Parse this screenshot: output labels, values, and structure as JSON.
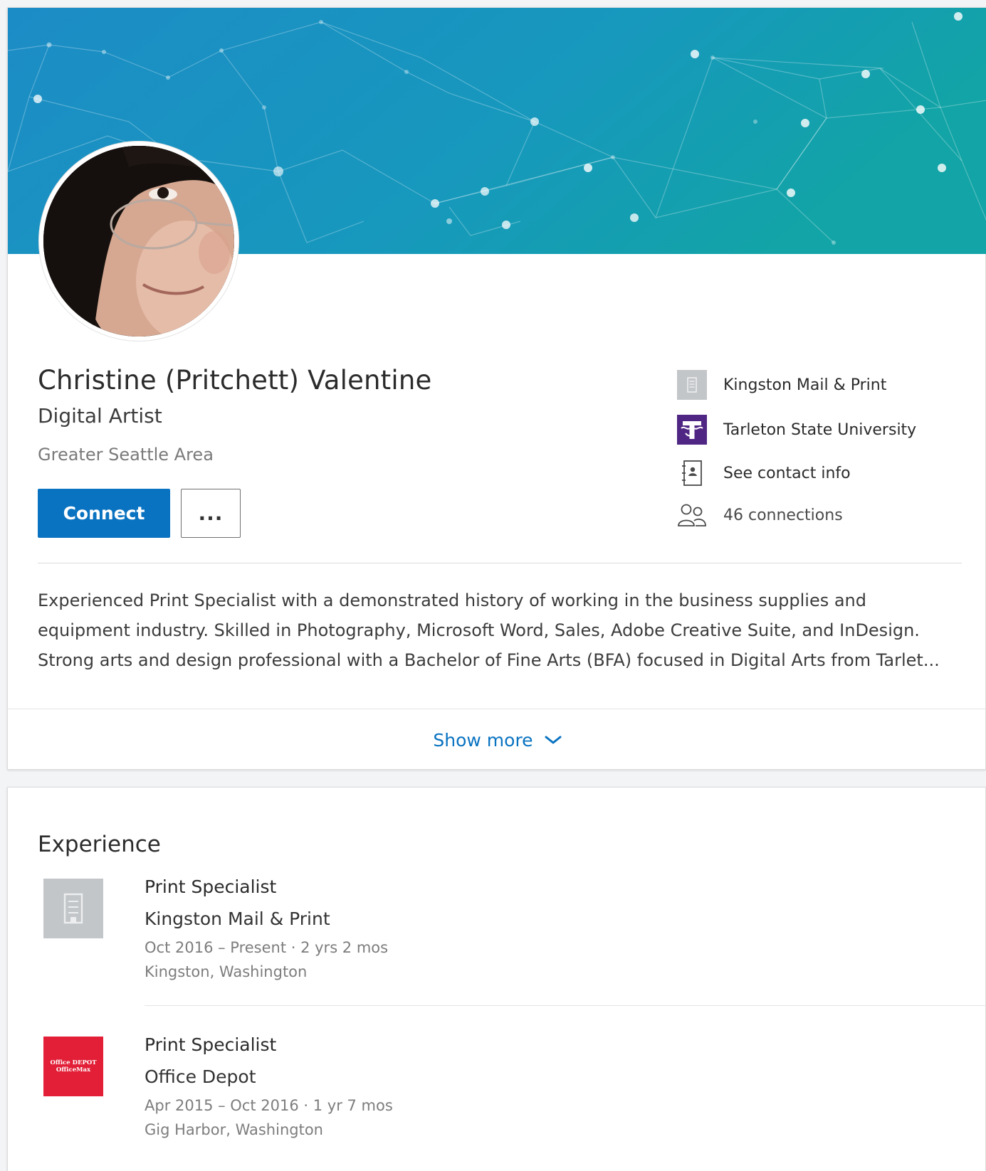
{
  "colors": {
    "banner_start": "#1a8fc7",
    "banner_end": "#12a3a8",
    "primary": "#0a73c1",
    "school_logo_bg": "#4f2683",
    "office_depot_red": "#e21f37",
    "placeholder_logo": "#c3c6c9"
  },
  "profile": {
    "name": "Christine (Pritchett) Valentine",
    "headline": "Digital Artist",
    "location": "Greater Seattle Area",
    "connect_label": "Connect",
    "more_label": "...",
    "side": {
      "company": {
        "icon": "building-icon",
        "label": "Kingston Mail & Print"
      },
      "school": {
        "icon": "school-logo-icon",
        "label": "Tarleton State University"
      },
      "contact": {
        "icon": "contact-card-icon",
        "label": "See contact info"
      },
      "connections": {
        "icon": "people-icon",
        "label": "46 connections"
      }
    },
    "summary_lines": [
      "Experienced Print Specialist with a demonstrated history of working in the business supplies and",
      "equipment industry. Skilled in Photography, Microsoft Word, Sales, Adobe Creative Suite, and InDesign.",
      "Strong arts and design professional with a Bachelor of Fine Arts (BFA) focused in Digital Arts from Tarlet..."
    ],
    "show_more_label": "Show more"
  },
  "experience": {
    "title": "Experience",
    "items": [
      {
        "title": "Print Specialist",
        "company": "Kingston Mail & Print",
        "dates": "Oct 2016 – Present · 2 yrs 2 mos",
        "location": "Kingston, Washington",
        "logo": "building-placeholder-icon"
      },
      {
        "title": "Print Specialist",
        "company": "Office Depot",
        "dates": "Apr 2015 – Oct 2016 · 1 yr 7 mos",
        "location": "Gig Harbor, Washington",
        "logo": "office-depot-logo",
        "logo_text_1": "Office DEPOT",
        "logo_text_2": "OfficeMax"
      }
    ]
  }
}
